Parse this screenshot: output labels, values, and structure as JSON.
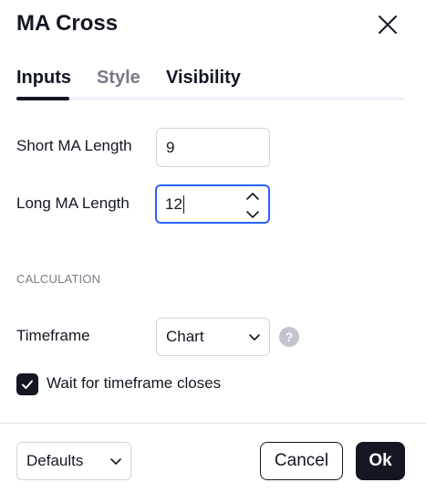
{
  "dialog": {
    "title": "MA Cross"
  },
  "tabs": [
    {
      "label": "Inputs",
      "active": true
    },
    {
      "label": "Style",
      "active": false
    },
    {
      "label": "Visibility",
      "active": false
    }
  ],
  "inputs": {
    "short_ma": {
      "label": "Short MA Length",
      "value": "9"
    },
    "long_ma": {
      "label": "Long MA Length",
      "value": "12"
    }
  },
  "calculation": {
    "section_title": "CALCULATION",
    "timeframe_label": "Timeframe",
    "timeframe_value": "Chart",
    "help_glyph": "?",
    "wait_label": "Wait for timeframe closes",
    "wait_checked": true
  },
  "footer": {
    "defaults_label": "Defaults",
    "cancel_label": "Cancel",
    "ok_label": "Ok"
  },
  "colors": {
    "accent": "#2962ff",
    "primary": "#131722",
    "muted": "#787b86"
  },
  "icons": {
    "close": "close-icon",
    "spinner_up": "chevron-up-icon",
    "spinner_down": "chevron-down-icon",
    "dropdown": "chevron-down-icon",
    "help": "question-icon",
    "check": "checkmark-icon"
  }
}
